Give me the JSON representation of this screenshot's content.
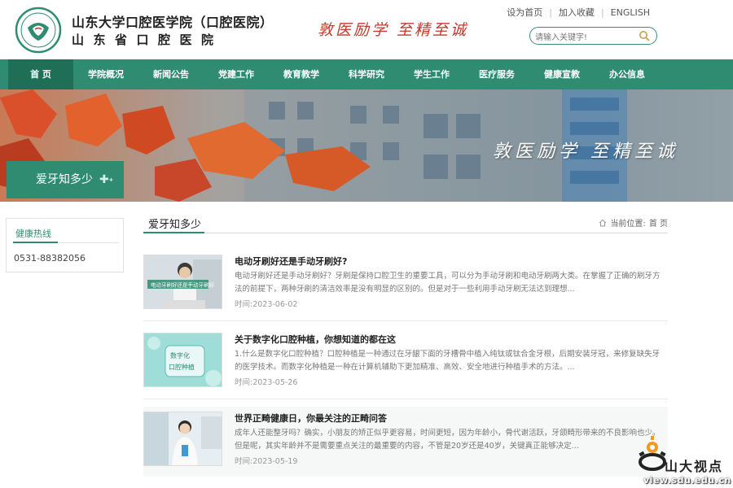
{
  "header": {
    "school_name": "山东大学口腔医学院（口腔医院）",
    "hospital_name": "山东省口腔医院",
    "motto": "敦医励学 至精至诚",
    "top_links": [
      "设为首页",
      "加入收藏",
      "ENGLISH"
    ],
    "search_placeholder": "请输入关键字!"
  },
  "nav": {
    "items": [
      "首 页",
      "学院概况",
      "新闻公告",
      "党建工作",
      "教育教学",
      "科学研究",
      "学生工作",
      "医疗服务",
      "健康宣教",
      "办公信息"
    ],
    "active_index": 0
  },
  "banner": {
    "slogan": "敦医励学  至精至诚",
    "tag": "爱牙知多少"
  },
  "sidebar": {
    "title": "健康热线",
    "phone": "0531-88382056"
  },
  "main": {
    "title": "爱牙知多少",
    "breadcrumb_label": "当前位置:",
    "breadcrumb_home": "首 页",
    "articles": [
      {
        "title": "电动牙刷好还是手动牙刷好?",
        "desc": "电动牙刷好还是手动牙刷好？牙刷是保持口腔卫生的重要工具，可以分为手动牙刷和电动牙刷两大类。在掌握了正确的刷牙方法的前提下，两种牙刷的清洁效率是没有明显的区别的。但是对于一些利用手动牙刷无法达到理想...",
        "date": "时间:2023-06-02",
        "thumb_caption": "电动牙刷好还是手动牙刷好"
      },
      {
        "title": "关于数字化口腔种植，你想知道的都在这",
        "desc": "1.什么是数字化口腔种植？口腔种植是一种通过在牙龈下面的牙槽骨中植入纯钛或钛合金牙根，后期安装牙冠，来修复缺失牙的医学技术。而数字化种植是一种在计算机辅助下更加精准、高效、安全地进行种植手术的方法。...",
        "date": "时间:2023-05-26",
        "thumb_caption": "数字化 口腔种植"
      },
      {
        "title": "世界正畸健康日，你最关注的正畸问答",
        "desc": "成年人还能整牙吗？确实，小朋友的矫正似乎更容易，时间更短，因为年龄小，骨代谢活跃，牙颌畸形带来的不良影响也少。但是呢，其实年龄并不是需要重点关注的最重要的内容，不管是20岁还是40岁，关键真正能够决定...",
        "date": "时间:2023-05-19",
        "thumb_caption": ""
      }
    ]
  },
  "watermark": {
    "name": "山大视点",
    "url": "view.sdu.edu.cn"
  },
  "colors": {
    "brand_green": "#2f8c70",
    "active_green": "#1e6f56",
    "motto_red": "#c0392b"
  }
}
